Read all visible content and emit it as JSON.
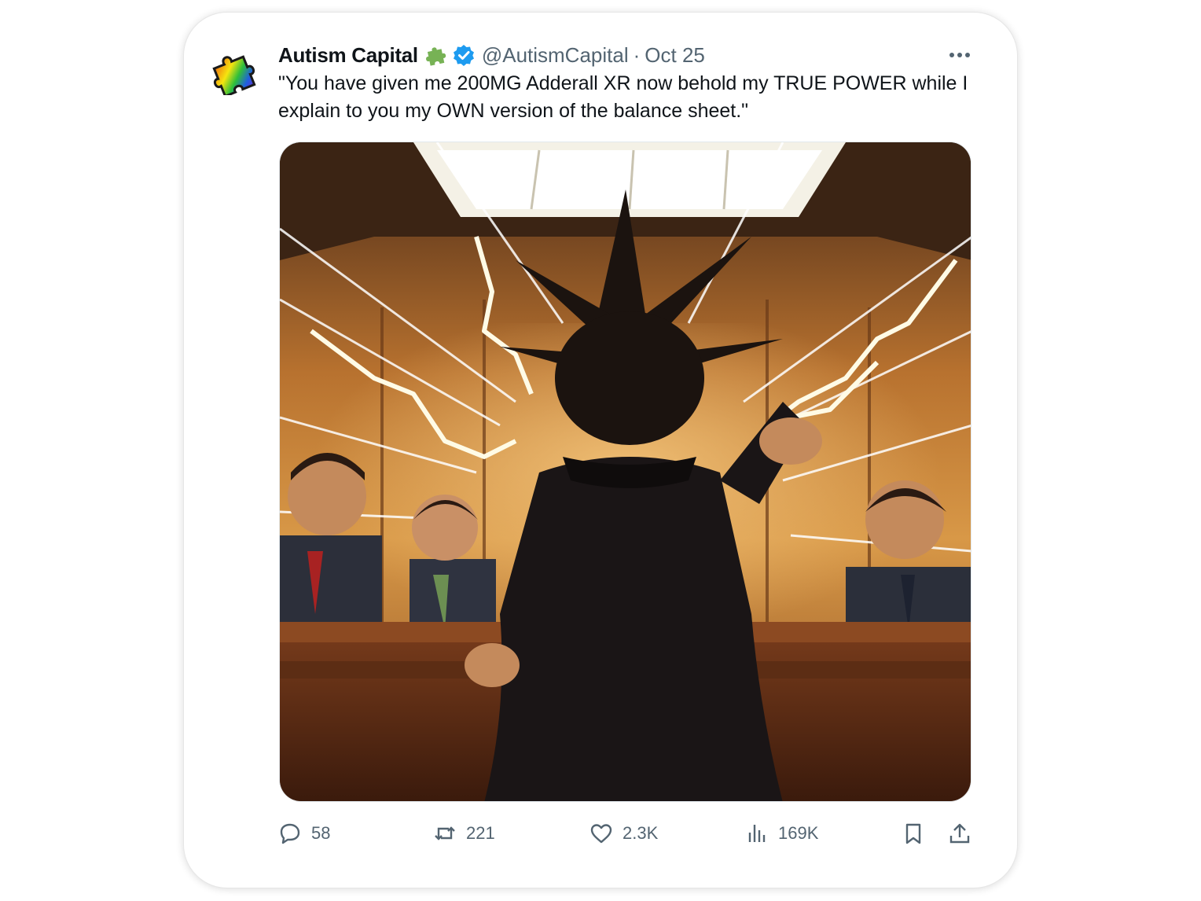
{
  "tweet": {
    "author_name": "Autism Capital",
    "handle": "@AutismCapital",
    "separator": "·",
    "date": "Oct 25",
    "text": "\"You have given me 200MG Adderall XR now behold my TRUE POWER while I explain to you my OWN version of the balance sheet.\"",
    "verified": true,
    "name_emoji": "puzzle-piece-green",
    "accent_color": "#1d9bf0"
  },
  "actions": {
    "replies": "58",
    "reposts": "221",
    "likes": "2.3K",
    "views": "169K"
  },
  "icons": {
    "avatar": "rainbow-puzzle-piece",
    "reply": "speech-bubble-icon",
    "repost": "repost-arrows-icon",
    "like": "heart-icon",
    "views": "bar-chart-icon",
    "bookmark": "bookmark-icon",
    "share": "share-upload-icon",
    "more": "ellipsis-icon"
  }
}
